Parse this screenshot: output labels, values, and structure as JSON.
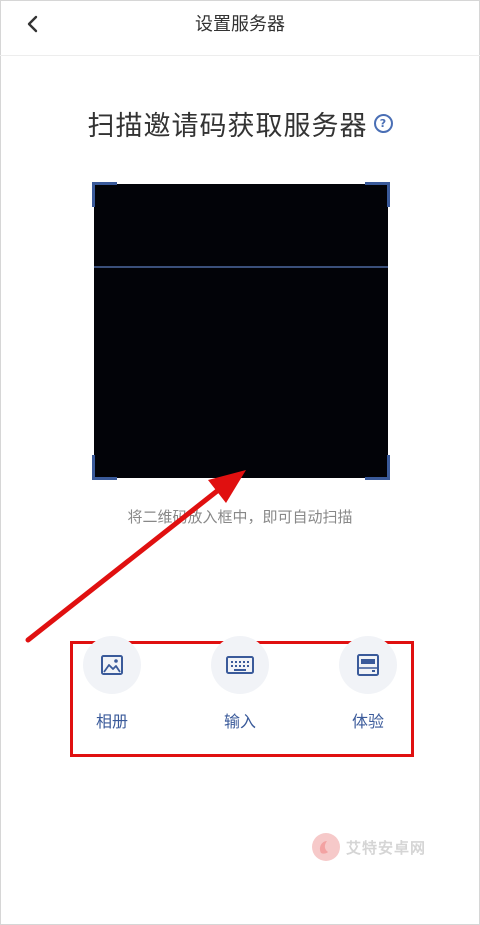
{
  "nav": {
    "title": "设置服务器"
  },
  "main": {
    "heading": "扫描邀请码获取服务器",
    "hint": "将二维码放入框中，即可自动扫描"
  },
  "actions": [
    {
      "label": "相册",
      "icon": "image-icon"
    },
    {
      "label": "输入",
      "icon": "keyboard-icon"
    },
    {
      "label": "体验",
      "icon": "demo-device-icon"
    }
  ],
  "watermark": {
    "text": "艾特安卓网"
  },
  "colors": {
    "accent": "#3a5a9a",
    "annotation": "#e01010",
    "scan_bg": "#020308"
  }
}
